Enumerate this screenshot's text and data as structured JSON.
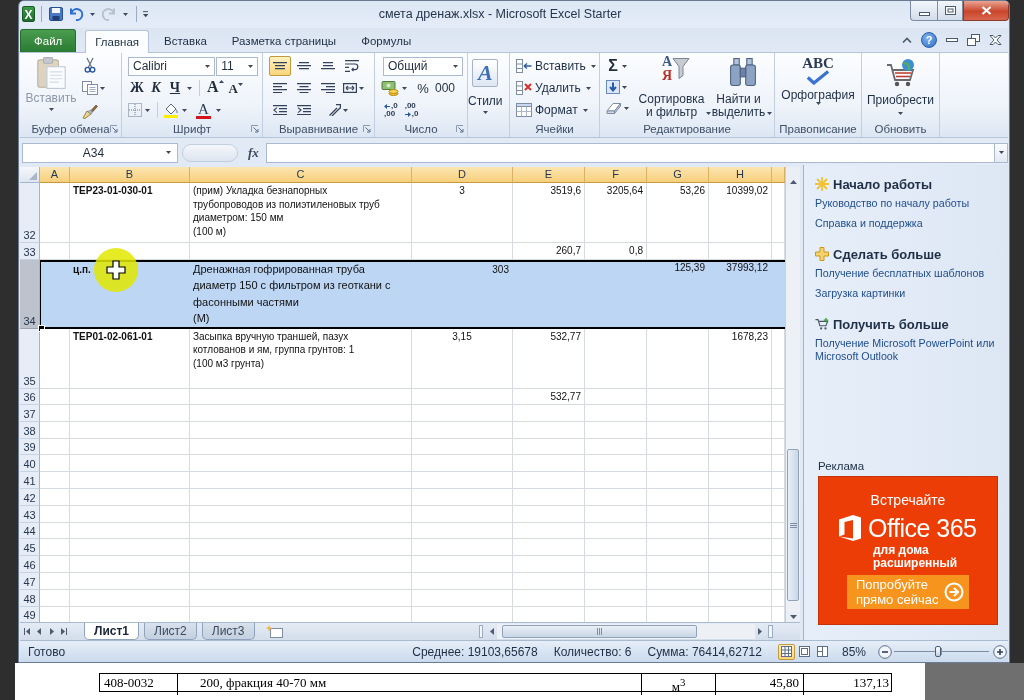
{
  "window": {
    "title": "смета дренаж.xlsx - Microsoft Excel Starter",
    "app_letter": "X"
  },
  "quick_access": {
    "undo": {
      "disabled": false
    },
    "redo": {
      "disabled": true
    }
  },
  "ribbon_tabs": [
    {
      "label": "Файл",
      "kind": "backstage",
      "selected": false
    },
    {
      "label": "Главная",
      "kind": "tab",
      "selected": true
    },
    {
      "label": "Вставка",
      "kind": "tab",
      "selected": false
    },
    {
      "label": "Разметка страницы",
      "kind": "tab",
      "selected": false
    },
    {
      "label": "Формулы",
      "kind": "tab",
      "selected": false
    }
  ],
  "help": {
    "label": "?"
  },
  "clipboard": {
    "label": "Буфер обмена",
    "paste": {
      "label": "Вставить",
      "disabled": true
    }
  },
  "font": {
    "label": "Шрифт",
    "name": "Calibri",
    "size": "11",
    "bold": "Ж",
    "italic": "К",
    "underline": "Ч",
    "grow": "A",
    "shrink": "A",
    "tint": "A"
  },
  "alignment": {
    "label": "Выравнивание",
    "buttons": [
      {
        "kind": "top",
        "selected": true
      },
      {
        "kind": "middle",
        "selected": false
      },
      {
        "kind": "bottom",
        "selected": false
      },
      {
        "kind": "wrap",
        "selected": false
      },
      {
        "kind": "left",
        "selected": false
      },
      {
        "kind": "center",
        "selected": false
      },
      {
        "kind": "right",
        "selected": false
      },
      {
        "kind": "merge",
        "selected": false
      },
      {
        "kind": "outdent",
        "selected": false
      },
      {
        "kind": "indent",
        "selected": false
      },
      {
        "kind": "orientation",
        "selected": false
      }
    ]
  },
  "number": {
    "label": "Число",
    "format": "Общий",
    "percent": "%",
    "thousands": "000",
    "increase_decimal": [
      ",0",
      ",00"
    ],
    "decrease_decimal": [
      ",00",
      ",0"
    ]
  },
  "styles": {
    "label": "Стили",
    "glyph": "A"
  },
  "cells": {
    "label": "Ячейки",
    "items": [
      {
        "kind": "insert",
        "label": "Вставить"
      },
      {
        "kind": "delete",
        "label": "Удалить"
      },
      {
        "kind": "format",
        "label": "Формат"
      }
    ]
  },
  "editing": {
    "label": "Редактирование",
    "sum": "Σ",
    "sort": {
      "label": "Сортировка\nи фильтр",
      "glyphs": [
        "А",
        "Я"
      ]
    },
    "find": {
      "label": "Найти и\nвыделить"
    }
  },
  "proofing": {
    "label": "Правописание",
    "spelling": {
      "label": "Орфография",
      "glyph": "ABC"
    }
  },
  "update": {
    "label": "Обновить",
    "buy": {
      "label": "Приобрести"
    }
  },
  "formula_bar": {
    "name_box": "A34",
    "function_label": "fx"
  },
  "sheet": {
    "columns": [
      {
        "label": "A",
        "highlighted": true
      },
      {
        "label": "B",
        "highlighted": true
      },
      {
        "label": "C",
        "highlighted": true
      },
      {
        "label": "D",
        "highlighted": true
      },
      {
        "label": "E",
        "highlighted": true
      },
      {
        "label": "F",
        "highlighted": true
      },
      {
        "label": "G",
        "highlighted": true
      },
      {
        "label": "H",
        "highlighted": true
      },
      {
        "highlighted": true
      }
    ],
    "rows": [
      {
        "number": "32",
        "kind": "item",
        "selected": false,
        "cells": {
          "b": "ТЕР23-01-030-01",
          "c": "(прим) Укладка безнапорных\nтрубопроводов из полиэтиленовых труб\nдиаметром: 150 мм\n(100 м)",
          "d": "3",
          "e": "3519,6",
          "f": "3205,64",
          "g": "53,26",
          "h": "10399,02"
        }
      },
      {
        "number": "33",
        "kind": "item",
        "selected": false,
        "cells": {
          "e": "260,7",
          "f": "0,8"
        }
      },
      {
        "number": "34",
        "kind": "material",
        "selected": true,
        "cells": {
          "b": "ц.п.",
          "c": "Дренажная гофрированная труба\nдиаметр 150 с фильтром из геоткани с\nфасонными частями\n(М)",
          "d": "303",
          "g": "125,39",
          "h": "37993,12"
        }
      },
      {
        "number": "35",
        "kind": "item",
        "selected": false,
        "cells": {
          "b": "ТЕР01-02-061-01",
          "c": "Засыпка вручную траншей, пазух\nкотлованов и ям, группа грунтов: 1\n(100 м3 грунта)",
          "d": "3,15",
          "e": "532,77",
          "h": "1678,23"
        }
      },
      {
        "number": "36",
        "kind": "item",
        "selected": false,
        "cells": {
          "e": "532,77"
        }
      },
      {
        "number": "37",
        "kind": "item",
        "selected": false
      },
      {
        "number": "38",
        "kind": "item",
        "selected": false
      },
      {
        "number": "39",
        "kind": "item",
        "selected": false
      },
      {
        "number": "40",
        "kind": "item",
        "selected": false
      },
      {
        "number": "41",
        "kind": "item",
        "selected": false
      },
      {
        "number": "42",
        "kind": "item",
        "selected": false
      },
      {
        "number": "43",
        "kind": "item",
        "selected": false
      },
      {
        "number": "44",
        "kind": "item",
        "selected": false
      },
      {
        "number": "45",
        "kind": "item",
        "selected": false
      },
      {
        "number": "46",
        "kind": "item",
        "selected": false
      },
      {
        "number": "47",
        "kind": "item",
        "selected": false
      },
      {
        "number": "48",
        "kind": "item",
        "selected": false
      },
      {
        "number": "49",
        "kind": "item",
        "selected": false
      }
    ]
  },
  "sheet_tabs": [
    {
      "label": "Лист1",
      "selected": true
    },
    {
      "label": "Лист2",
      "selected": false
    },
    {
      "label": "Лист3",
      "selected": false
    }
  ],
  "status_bar": {
    "state": "Готово",
    "average": "Среднее: 19103,65678",
    "count": "Количество: 6",
    "sum": "Сумма: 76414,62712",
    "views": [
      {
        "kind": "normal",
        "selected": true
      },
      {
        "kind": "page_layout",
        "selected": false
      },
      {
        "kind": "page_break",
        "selected": false
      }
    ],
    "zoom": "85%",
    "zoom_slider": {
      "level": 0.46
    }
  },
  "task_pane": {
    "sections": [
      {
        "kind": "start",
        "title": "Начало работы",
        "links": [
          "Руководство по началу работы",
          "Справка и поддержка"
        ]
      },
      {
        "kind": "more",
        "title": "Сделать больше",
        "links": [
          "Получение бесплатных шаблонов",
          "Загрузка картинки"
        ]
      },
      {
        "kind": "get",
        "title": "Получить больше",
        "links": [
          "Получение Microsoft PowerPoint или Microsoft Outlook"
        ]
      }
    ],
    "ad": {
      "label": "Реклама",
      "headline": "Встречайте",
      "product": "Office 365",
      "subtitle": "для дома\nрасширенный",
      "button": "Попробуйте\nпрямо сейчас"
    }
  },
  "background_document": {
    "rows": [
      {
        "cells": [
          "408-0032",
          "200, фракция 40-70 мм",
          "м$^{3}$",
          "45,80",
          "137,13"
        ]
      }
    ]
  }
}
